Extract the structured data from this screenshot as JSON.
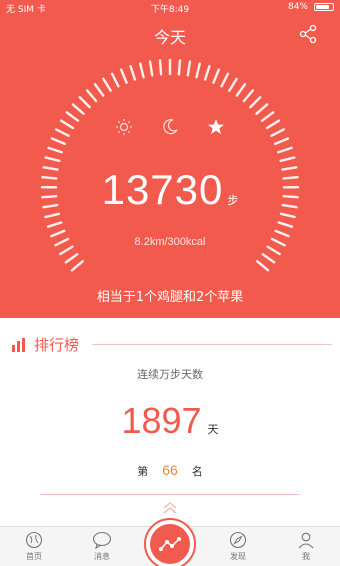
{
  "status": {
    "carrier": "无 SIM 卡",
    "time": "下午8:49",
    "battery": "84%",
    "battery_level": 0.84
  },
  "header": {
    "title": "今天",
    "share_icon": "share-icon"
  },
  "dial": {
    "mode_icons": [
      "sun-icon",
      "moon-icon",
      "star-icon"
    ],
    "active_mode": "star-icon"
  },
  "summary": {
    "steps": "13730",
    "steps_unit": "步",
    "distance_energy": "8.2km/300kcal",
    "equivalent": "相当于1个鸡腿和2个苹果"
  },
  "ranking": {
    "title": "排行榜",
    "streak_label": "连续万步天数",
    "streak_value": "1897",
    "streak_unit": "天",
    "rank_prefix": "第",
    "rank_value": "66",
    "rank_suffix": "名"
  },
  "tabs": [
    {
      "label": "首页",
      "icon": "home-globe-icon"
    },
    {
      "label": "消息",
      "icon": "chat-bubble-icon"
    },
    {
      "label": "",
      "icon": "trend-line-icon"
    },
    {
      "label": "发现",
      "icon": "compass-icon"
    },
    {
      "label": "我",
      "icon": "person-icon"
    }
  ],
  "colors": {
    "primary": "#f25a4e",
    "accent": "#e8893a"
  }
}
